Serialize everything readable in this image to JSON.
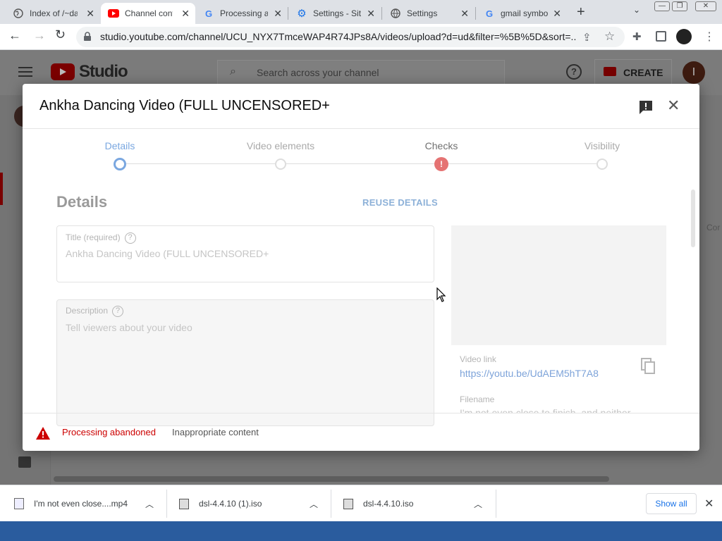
{
  "browser": {
    "tabs": [
      {
        "title": "Index of /~da",
        "icon": "globe-icon"
      },
      {
        "title": "Channel conte",
        "icon": "youtube-icon"
      },
      {
        "title": "Processing ab",
        "icon": "google-icon"
      },
      {
        "title": "Settings - Site",
        "icon": "gear-icon"
      },
      {
        "title": "Settings",
        "icon": "globe-icon"
      },
      {
        "title": "gmail symbol",
        "icon": "google-icon"
      }
    ],
    "new_tab": "+",
    "url": "studio.youtube.com/channel/UCU_NYX7TmceWAP4R74JPs8A/videos/upload?d=ud&filter=%5B%5D&sort=..."
  },
  "studio": {
    "logo_text": "Studio",
    "search_placeholder": "Search across your channel",
    "create_label": "CREATE",
    "avatar_letter": "I",
    "right_partial": "Cor"
  },
  "dialog": {
    "title": "Ankha Dancing Video (FULL UNCENSORED+",
    "steps": [
      {
        "label": "Details"
      },
      {
        "label": "Video elements"
      },
      {
        "label": "Checks"
      },
      {
        "label": "Visibility"
      }
    ],
    "section_title": "Details",
    "reuse_label": "REUSE DETAILS",
    "title_label": "Title (required)",
    "title_value": "Ankha Dancing Video (FULL UNCENSORED+",
    "description_label": "Description",
    "description_placeholder": "Tell viewers about your video",
    "video_link_label": "Video link",
    "video_link": "https://youtu.be/UdAEM5hT7A8",
    "filename_label": "Filename",
    "filename_value": "I'm not even close to finish, and neither",
    "status_error": "Processing abandoned",
    "status_reason": "Inappropriate content",
    "colors": {
      "error": "#c00",
      "link": "#7da3d9",
      "step_active": "#7aa7e0"
    }
  },
  "downloads": {
    "items": [
      {
        "name": "I'm not even close....mp4"
      },
      {
        "name": "dsl-4.4.10 (1).iso"
      },
      {
        "name": "dsl-4.4.10.iso"
      }
    ],
    "show_all": "Show all"
  }
}
